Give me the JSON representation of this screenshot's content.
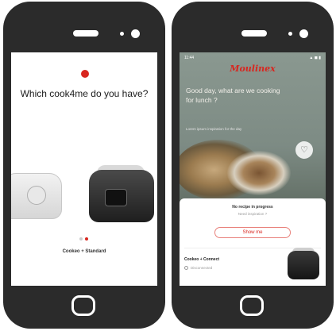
{
  "left_screen": {
    "question": "Which cook4me do you have?",
    "model_label": "Cookeo + Standard",
    "pager": {
      "count": 2,
      "active_index": 1
    }
  },
  "right_screen": {
    "status": {
      "time": "11:44",
      "icons": "▲ ◼ ▮"
    },
    "brand": "Moulinex",
    "greeting": "Good day, what are we cooking for lunch ?",
    "greeting_sub": "Lorem ipsum inspiration for the day",
    "sheet": {
      "title": "No recipe in progress",
      "subtitle": "Need inspiration ?",
      "button_label": "Show me",
      "device_name": "Cookeo + Connect",
      "device_status": "Disconnected"
    }
  },
  "colors": {
    "accent": "#d8261f",
    "phone_frame": "#2b2b2b"
  },
  "icons": {
    "favorite": "heart-icon",
    "home": "home-button-icon"
  }
}
